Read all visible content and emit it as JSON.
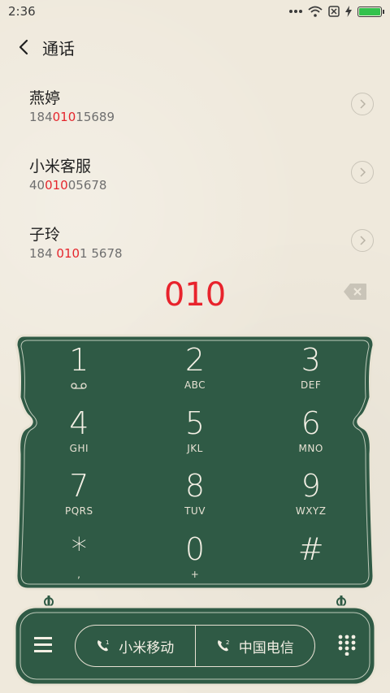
{
  "status_bar": {
    "time": "2:36",
    "icons": [
      "more-dots-icon",
      "wifi-icon",
      "no-sim-icon",
      "charging-icon",
      "battery-icon"
    ],
    "battery_level": 1.0,
    "battery_color": "#33c24d"
  },
  "header": {
    "title": "通话",
    "back_icon": "chevron-left-icon"
  },
  "results": [
    {
      "name": "燕婷",
      "number_pre": "184",
      "number_match": "010",
      "number_post": "15689"
    },
    {
      "name": "小米客服",
      "number_pre": "40",
      "number_match": "010",
      "number_post": "05678"
    },
    {
      "name": "子玲",
      "number_pre": "184 ",
      "number_match": "010",
      "number_post": "1 5678"
    }
  ],
  "dialed": "010",
  "keypad": [
    {
      "digit": "1",
      "letters": "",
      "icon": "voicemail-icon"
    },
    {
      "digit": "2",
      "letters": "ABC"
    },
    {
      "digit": "3",
      "letters": "DEF"
    },
    {
      "digit": "4",
      "letters": "GHI"
    },
    {
      "digit": "5",
      "letters": "JKL"
    },
    {
      "digit": "6",
      "letters": "MNO"
    },
    {
      "digit": "7",
      "letters": "PQRS"
    },
    {
      "digit": "8",
      "letters": "TUV"
    },
    {
      "digit": "9",
      "letters": "WXYZ"
    },
    {
      "digit": "*",
      "letters": ","
    },
    {
      "digit": "0",
      "letters": "+"
    },
    {
      "digit": "#",
      "letters": ""
    }
  ],
  "bottom": {
    "sim1_label": "小米移动",
    "sim2_label": "中国电信",
    "menu_icon": "hamburger-menu-icon",
    "dialpad_icon": "dialpad-toggle-icon"
  },
  "colors": {
    "background": "#efe9dc",
    "panel_green": "#2f5a45",
    "highlight_red": "#e5262d"
  }
}
